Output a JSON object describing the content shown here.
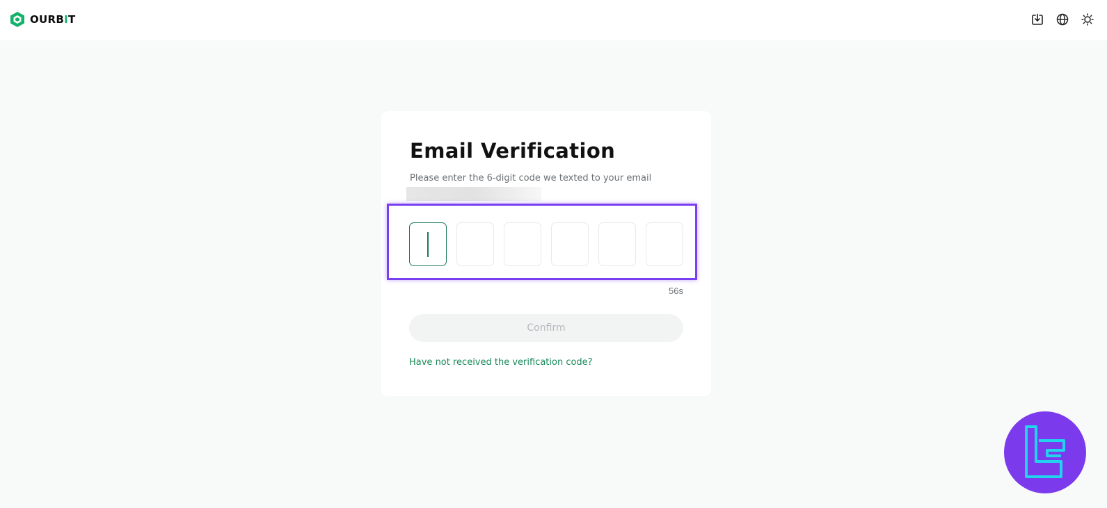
{
  "brand": {
    "name_main": "OURB",
    "name_accent": "I",
    "name_end": "T",
    "accent_color": "#12b26b"
  },
  "header_icons": [
    "download-icon",
    "globe-icon",
    "sun-icon"
  ],
  "verification": {
    "title": "Email Verification",
    "subtitle": "Please enter the 6-digit code we texted to your email",
    "code_length": 6,
    "timer": "56s",
    "confirm_label": "Confirm",
    "resend_link": "Have not received the verification code?"
  },
  "colors": {
    "highlight": "#7a3ff0",
    "active_border": "#1a7a55",
    "badge": "#7c3aed",
    "badge_mark": "#22d3ee"
  }
}
